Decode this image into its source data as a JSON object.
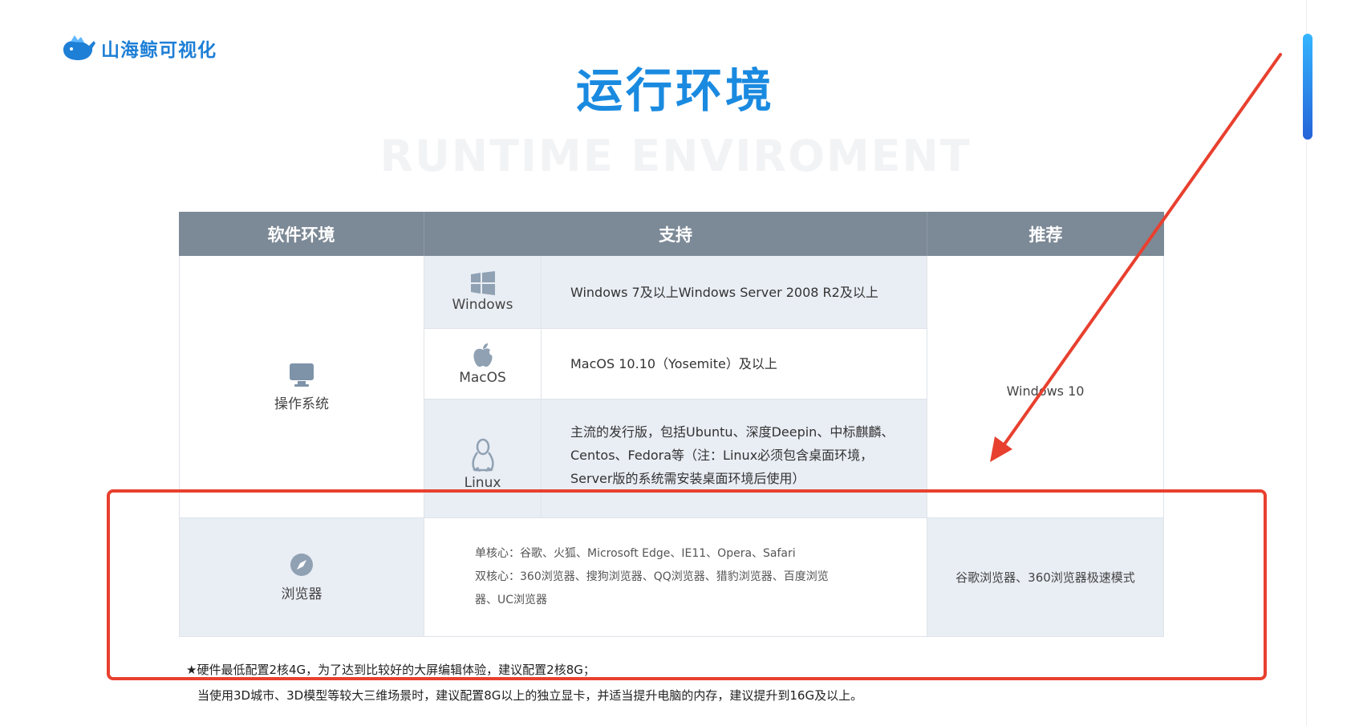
{
  "header": {
    "logo_text": "山海鲸可视化",
    "title": "运行环境",
    "subtitle": "RUNTIME ENVIROMENT"
  },
  "table": {
    "headers": [
      "软件环境",
      "支持",
      "推荐"
    ],
    "os": {
      "label": "操作系统",
      "icon_text": "OS",
      "recommend": "Windows 10",
      "rows": [
        {
          "name": "Windows",
          "desc": "Windows 7及以上Windows Server 2008 R2及以上"
        },
        {
          "name": "MacOS",
          "desc": "MacOS 10.10（Yosemite）及以上"
        },
        {
          "name": "Linux",
          "desc": "主流的发行版，包括Ubuntu、深度Deepin、中标麒麟、Centos、Fedora等（注：Linux必须包含桌面环境，Server版的系统需安装桌面环境后使用）"
        }
      ]
    },
    "browser": {
      "label": "浏览器",
      "line1": "单核心：谷歌、火狐、Microsoft Edge、IE11、Opera、Safari",
      "line2": "双核心：360浏览器、搜狗浏览器、QQ浏览器、猎豹浏览器、百度浏览器、UC浏览器",
      "recommend": "谷歌浏览器、360浏览器极速模式"
    }
  },
  "notes": {
    "line1": "★硬件最低配置2核4G，为了达到比较好的大屏编辑体验，建议配置2核8G；",
    "line2": "当使用3D城市、3D模型等较大三维场景时，建议配置8G以上的独立显卡，并适当提升电脑的内存，建议提升到16G及以上。"
  },
  "colors": {
    "brand": "#1a8ae0",
    "header_bg": "#7c8996",
    "row_alt_bg": "#e9edf4",
    "annotation": "#e8402f"
  }
}
